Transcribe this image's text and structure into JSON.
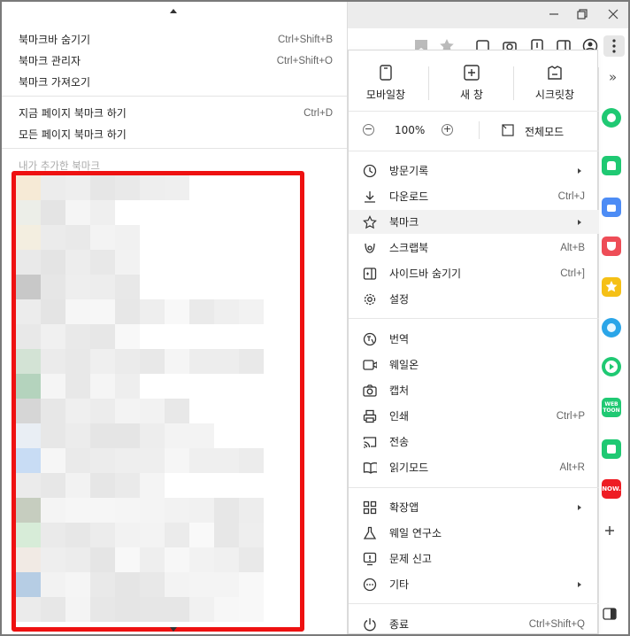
{
  "bookmark_menu": {
    "items": [
      {
        "label": "북마크바 숨기기",
        "shortcut": "Ctrl+Shift+B"
      },
      {
        "label": "북마크 관리자",
        "shortcut": "Ctrl+Shift+O"
      },
      {
        "label": "북마크 가져오기",
        "shortcut": ""
      },
      {
        "label": "지금 페이지 북마크 하기",
        "shortcut": "Ctrl+D"
      },
      {
        "label": "모든 페이지 북마크 하기",
        "shortcut": ""
      }
    ],
    "section_label": "내가 추가한 북마크"
  },
  "quick_actions": [
    {
      "label": "모바일창",
      "icon": "mobile-window-icon"
    },
    {
      "label": "새 창",
      "icon": "new-window-icon"
    },
    {
      "label": "시크릿창",
      "icon": "secret-window-icon"
    }
  ],
  "zoom": {
    "value": "100%",
    "minus": "−",
    "plus": "+",
    "fullscreen_label": "전체모드"
  },
  "menu_items": [
    {
      "label": "방문기록",
      "shortcut": "",
      "submenu": true,
      "icon": "history-icon"
    },
    {
      "label": "다운로드",
      "shortcut": "Ctrl+J",
      "submenu": false,
      "icon": "download-icon"
    },
    {
      "label": "북마크",
      "shortcut": "",
      "submenu": true,
      "icon": "star-icon"
    },
    {
      "label": "스크랩북",
      "shortcut": "Alt+B",
      "submenu": false,
      "icon": "scrapbook-icon"
    },
    {
      "label": "사이드바 숨기기",
      "shortcut": "Ctrl+]",
      "submenu": false,
      "icon": "sidebar-icon"
    },
    {
      "label": "설정",
      "shortcut": "",
      "submenu": false,
      "icon": "gear-icon"
    },
    {
      "label": "번역",
      "shortcut": "",
      "submenu": false,
      "icon": "translate-icon"
    },
    {
      "label": "웨일온",
      "shortcut": "",
      "submenu": false,
      "icon": "video-icon"
    },
    {
      "label": "캡처",
      "shortcut": "",
      "submenu": false,
      "icon": "camera-icon"
    },
    {
      "label": "인쇄",
      "shortcut": "Ctrl+P",
      "submenu": false,
      "icon": "print-icon"
    },
    {
      "label": "전송",
      "shortcut": "",
      "submenu": false,
      "icon": "cast-icon"
    },
    {
      "label": "읽기모드",
      "shortcut": "Alt+R",
      "submenu": false,
      "icon": "book-icon"
    },
    {
      "label": "확장앱",
      "shortcut": "",
      "submenu": true,
      "icon": "extensions-icon"
    },
    {
      "label": "웨일 연구소",
      "shortcut": "",
      "submenu": false,
      "icon": "flask-icon"
    },
    {
      "label": "문제 신고",
      "shortcut": "",
      "submenu": false,
      "icon": "report-icon"
    },
    {
      "label": "기타",
      "shortcut": "",
      "submenu": true,
      "icon": "more-icon"
    },
    {
      "label": "종료",
      "shortcut": "Ctrl+Shift+Q",
      "submenu": false,
      "icon": "power-icon"
    }
  ],
  "sidebar_apps": [
    {
      "icon": "whale-app-icon",
      "color": "#1fc973"
    },
    {
      "icon": "notification-icon",
      "color": "#1fc973"
    },
    {
      "icon": "calendar-icon",
      "color": "#4d8cf5"
    },
    {
      "icon": "pocket-icon",
      "color": "#ee4d57"
    },
    {
      "icon": "favorite-icon",
      "color": "#f5c016"
    },
    {
      "icon": "papago-icon",
      "color": "#2aa5e8"
    },
    {
      "icon": "play-icon",
      "color": "#1fc973"
    },
    {
      "icon": "webtoon-icon",
      "color": "#1fc973"
    },
    {
      "icon": "line-icon",
      "color": "#1fc973"
    },
    {
      "icon": "now-icon",
      "color": "#ee1c24"
    }
  ],
  "dock_labels": {
    "webtoon": "WEB TOON",
    "now": "NOW."
  },
  "overflow_label": "»",
  "colors": {
    "highlight_box": "#ee1111",
    "menu_hover": "#f2f2f2"
  }
}
